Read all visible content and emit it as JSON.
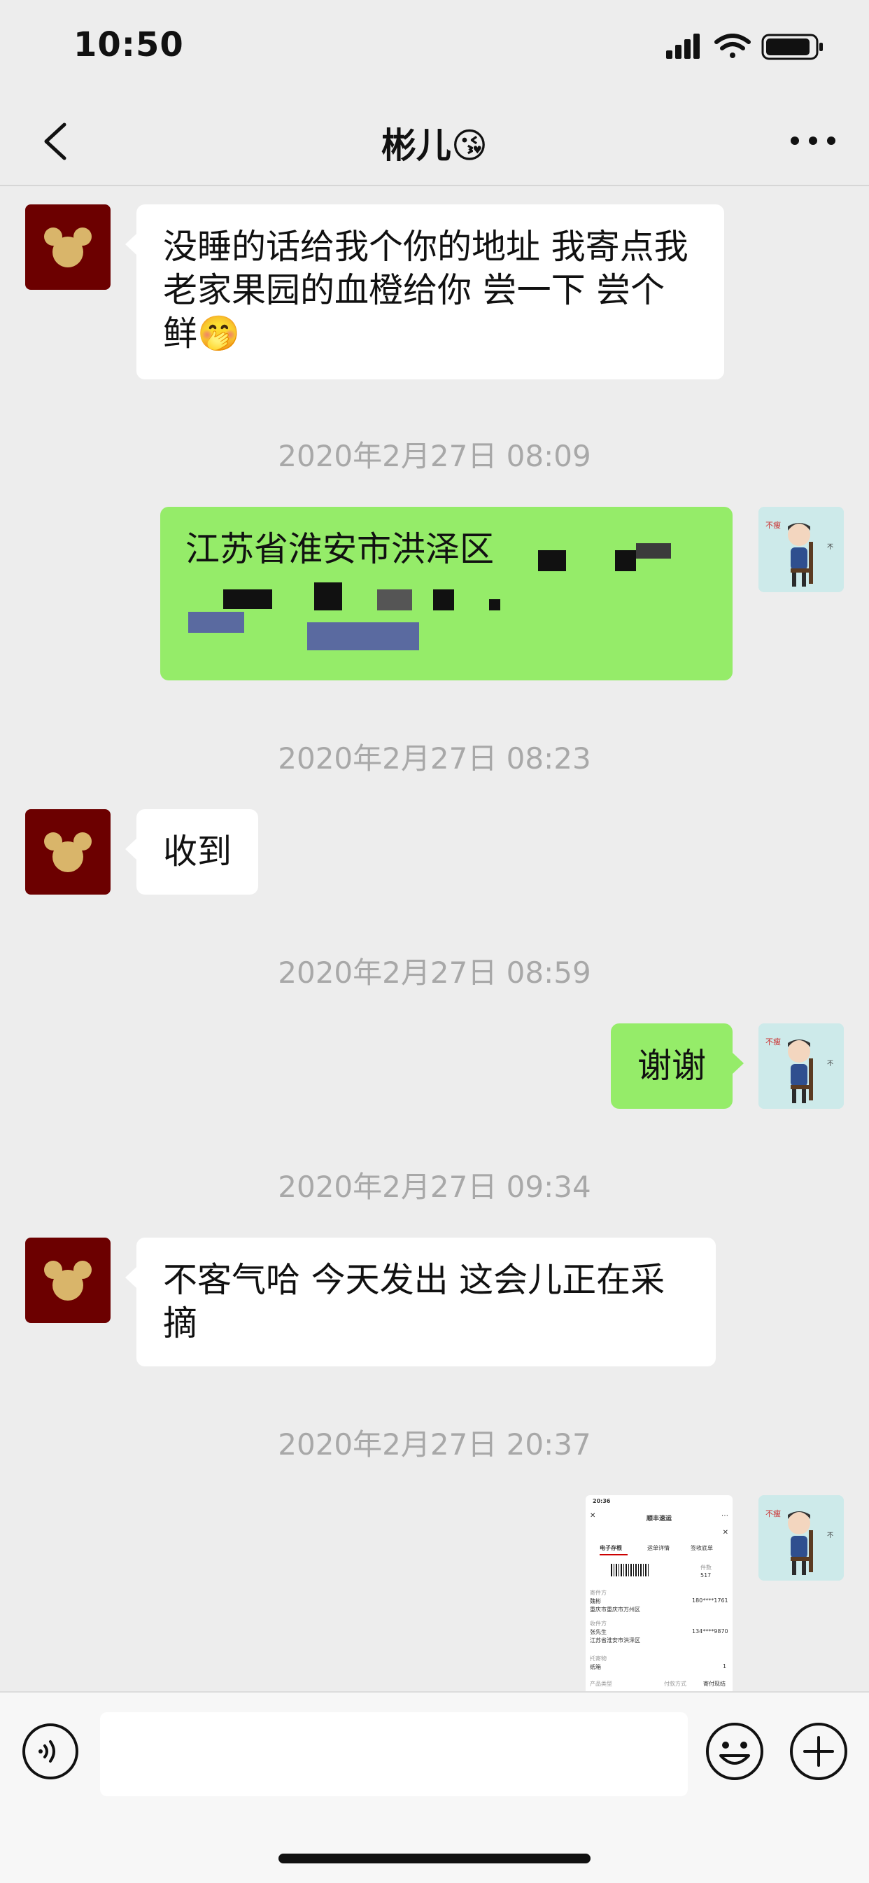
{
  "status_bar": {
    "time": "10:50"
  },
  "header": {
    "title": "彬儿😘"
  },
  "messages": [
    {
      "sender": "other",
      "text": "没睡的话给我个你的地址 我寄点我老家果园的血橙给你  尝一下 尝个鲜🤭"
    },
    {
      "timestamp": "2020年2月27日 08:09"
    },
    {
      "sender": "me",
      "type": "redacted-address",
      "text": "江苏省淮安市洪泽区"
    },
    {
      "timestamp": "2020年2月27日 08:23"
    },
    {
      "sender": "other",
      "text": "收到"
    },
    {
      "timestamp": "2020年2月27日 08:59"
    },
    {
      "sender": "me",
      "text": "谢谢"
    },
    {
      "timestamp": "2020年2月27日 09:34"
    },
    {
      "sender": "other",
      "text": "不客气哈 今天发出 这会儿正在采摘"
    },
    {
      "timestamp": "2020年2月27日 20:37"
    },
    {
      "sender": "me",
      "type": "image",
      "image": {
        "time": "20:36",
        "title": "顺丰速运",
        "tabs": [
          "电子存根",
          "运单详情",
          "签收底单"
        ],
        "count_label": "件数",
        "count_value": "517",
        "sender_label": "寄件方",
        "sender_name": "魏彬",
        "sender_phone": "180****1761",
        "sender_addr": "重庆市重庆市万州区",
        "receiver_label": "收件方",
        "receiver_name": "张先生",
        "receiver_phone": "134****9870",
        "receiver_addr": "江苏省淮安市洪泽区",
        "item_label": "托寄物",
        "item_value": "纸箱",
        "item_count": "1",
        "product_label": "产品类型",
        "payment_label": "付款方式",
        "payment_value": "寄付现结"
      }
    }
  ],
  "input_bar": {
    "placeholder": ""
  },
  "colors": {
    "my_bubble": "#95ec69",
    "other_bubble": "#ffffff",
    "background": "#ededed",
    "other_avatar": "#6c0000"
  },
  "icons": [
    "back-arrow-icon",
    "more-icon",
    "voice-icon",
    "emoji-icon",
    "plus-icon",
    "signal-icon",
    "wifi-icon",
    "battery-icon"
  ]
}
